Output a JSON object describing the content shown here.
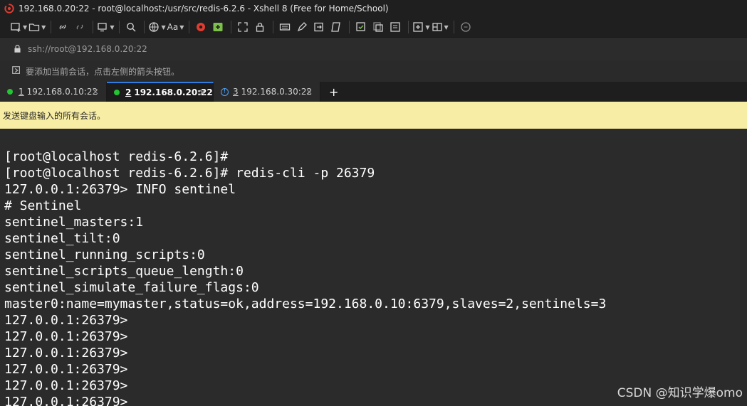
{
  "window": {
    "title": "192.168.0.20:22 - root@localhost:/usr/src/redis-6.2.6 - Xshell 8 (Free for Home/School)"
  },
  "address": {
    "text": "ssh://root@192.168.0.20:22"
  },
  "hint": {
    "text": "要添加当前会话，点击左侧的箭头按钮。"
  },
  "tabs": [
    {
      "num": "1",
      "label": "192.168.0.10:22",
      "status": "connected",
      "active": false
    },
    {
      "num": "2",
      "label": "192.168.0.20:22",
      "status": "connected",
      "active": true
    },
    {
      "num": "3",
      "label": "192.168.0.30:22",
      "status": "info",
      "active": false
    }
  ],
  "tab_add_label": "+",
  "tab_close_label": "×",
  "notice": {
    "text": "发送键盘输入的所有会话。"
  },
  "terminal": {
    "lines": [
      "[root@localhost redis-6.2.6]#",
      "[root@localhost redis-6.2.6]# redis-cli -p 26379",
      "127.0.0.1:26379> INFO sentinel",
      "# Sentinel",
      "sentinel_masters:1",
      "sentinel_tilt:0",
      "sentinel_running_scripts:0",
      "sentinel_scripts_queue_length:0",
      "sentinel_simulate_failure_flags:0",
      "master0:name=mymaster,status=ok,address=192.168.0.10:6379,slaves=2,sentinels=3",
      "127.0.0.1:26379>",
      "127.0.0.1:26379>",
      "127.0.0.1:26379>",
      "127.0.0.1:26379>",
      "127.0.0.1:26379>",
      "127.0.0.1:26379>"
    ]
  },
  "watermark": {
    "text": "CSDN @知识学爆omo"
  },
  "colors": {
    "status_connected": "#22c532",
    "status_info": "#4aa3ff",
    "notice_bg": "#f8eda4",
    "active_tab_accent": "#2f7de1"
  }
}
